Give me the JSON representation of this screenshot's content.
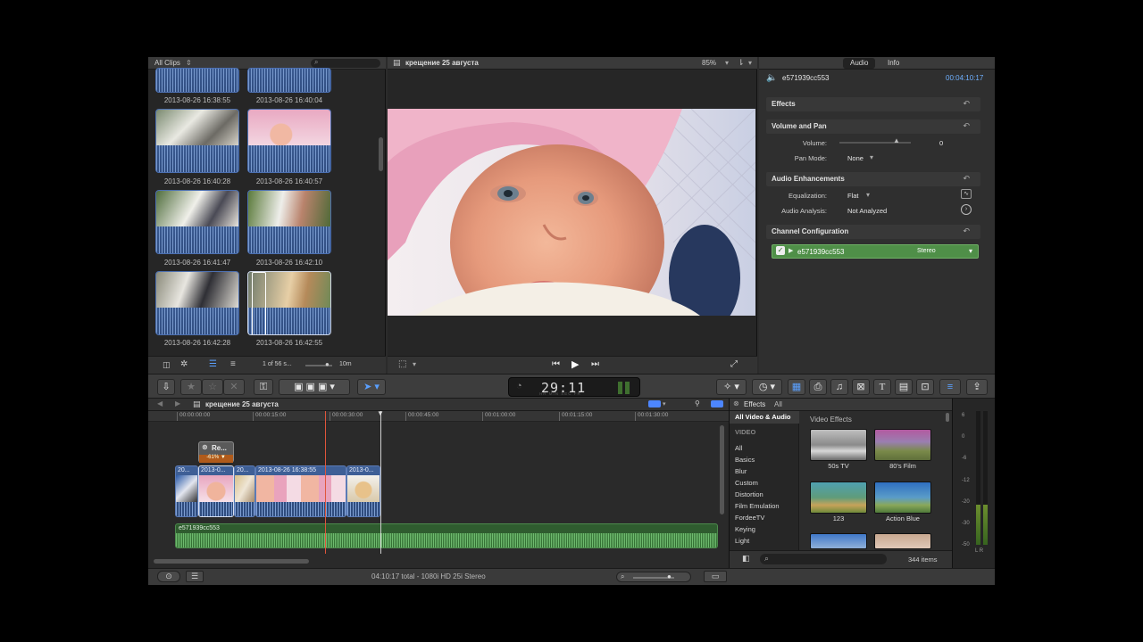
{
  "browser": {
    "filter_label": "All Clips",
    "clips": [
      {
        "label": "2013-08-26 16:38:55"
      },
      {
        "label": "2013-08-26 16:40:04"
      },
      {
        "label": "2013-08-26 16:40:28"
      },
      {
        "label": "2013-08-26 16:40:57"
      },
      {
        "label": "2013-08-26 16:41:47"
      },
      {
        "label": "2013-08-26 16:42:10"
      },
      {
        "label": "2013-08-26 16:42:28"
      },
      {
        "label": "2013-08-26 16:42:55"
      }
    ],
    "selection_count": "1 of 56 s...",
    "duration_zoom": "10m"
  },
  "viewer": {
    "title": "крещение 25 августа",
    "zoom": "85%"
  },
  "inspector": {
    "tabs": [
      "Audio",
      "Info"
    ],
    "clip_name": "e571939cc553",
    "duration": "00:04:10:17",
    "sections": {
      "effects": "Effects",
      "volume_pan": "Volume and Pan",
      "enhancements": "Audio Enhancements",
      "channel_config": "Channel Configuration"
    },
    "volume_label": "Volume:",
    "volume_value": "0",
    "pan_mode_label": "Pan Mode:",
    "pan_mode_value": "None",
    "equalization_label": "Equalization:",
    "equalization_value": "Flat",
    "analysis_label": "Audio Analysis:",
    "analysis_value": "Not Analyzed",
    "channel_name": "e571939cc553",
    "channel_mode": "Stereo"
  },
  "toolbar": {
    "timecode": "29:11",
    "timecode_units": "HR MIN SEC FR"
  },
  "timeline": {
    "project": "крещение 25 августа",
    "ruler": [
      "00:00:00:00",
      "00:00:15:00",
      "00:00:30:00",
      "00:00:45:00",
      "00:01:00:00",
      "00:01:15:00",
      "00:01:30:00"
    ],
    "title_clip": "Re...",
    "title_pct": "-61% ▼",
    "clips": [
      "20...",
      "2013-0...",
      "20...",
      "2013-08-26 16:38:55",
      "2013-0..."
    ],
    "audio_clip": "e571939cc553"
  },
  "effects": {
    "header": "Effects",
    "filter": "All",
    "categories": [
      "All Video & Audio",
      "VIDEO",
      "All",
      "Basics",
      "Blur",
      "Custom",
      "Distortion",
      "Film Emulation",
      "FordeeTV",
      "Keying",
      "Light"
    ],
    "section_title": "Video Effects",
    "items": [
      {
        "name": "50s TV"
      },
      {
        "name": "80's Film"
      },
      {
        "name": "123"
      },
      {
        "name": "Action Blue"
      }
    ],
    "count": "344 items"
  },
  "meters": {
    "labels": [
      "6",
      "0",
      "-6",
      "-12",
      "-20",
      "-30",
      "-50"
    ],
    "lr": "L R"
  },
  "status": {
    "text": "04:10:17 total - 1080i HD 25i Stereo"
  }
}
